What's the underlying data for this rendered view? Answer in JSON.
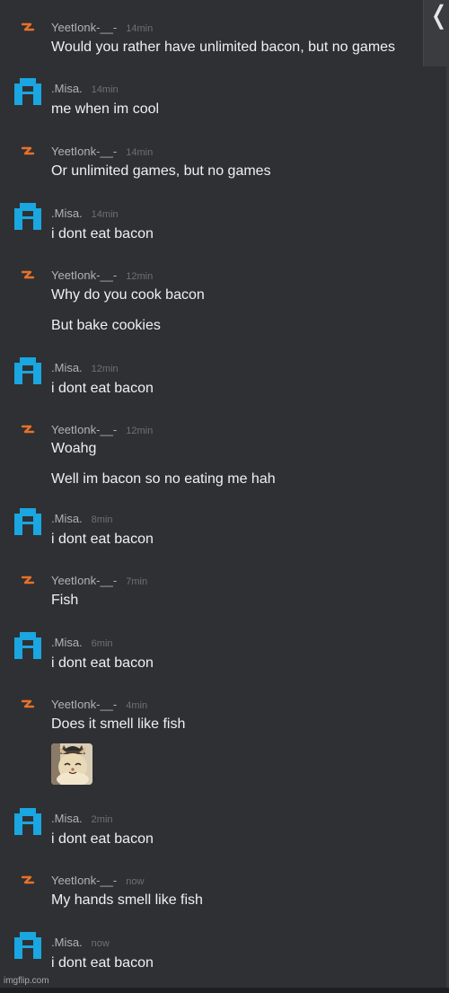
{
  "colors": {
    "background": "#2f3033",
    "author": "#b3b3b7",
    "text": "#f0f0f2",
    "yeet_icon": "#e8702a",
    "misa_icon": "#1aa6e0"
  },
  "handle": {
    "label": "❬"
  },
  "watermark": "imgflip.com",
  "messages": [
    {
      "author": "YeetIonk-__-",
      "time": "14min",
      "icon": "orange-bolt-icon",
      "lines": [
        "Would you rather have unlimited bacon, but no games"
      ]
    },
    {
      "author": ".Misa.",
      "time": "14min",
      "icon": "blue-pixel-avatar-icon",
      "lines": [
        "me when im cool"
      ]
    },
    {
      "author": "YeetIonk-__-",
      "time": "14min",
      "icon": "orange-bolt-icon",
      "lines": [
        "Or unlimited games, but no games"
      ]
    },
    {
      "author": ".Misa.",
      "time": "14min",
      "icon": "blue-pixel-avatar-icon",
      "lines": [
        "i dont eat bacon"
      ]
    },
    {
      "author": "YeetIonk-__-",
      "time": "12min",
      "icon": "orange-bolt-icon",
      "lines": [
        "Why do you cook bacon",
        "But bake cookies"
      ]
    },
    {
      "author": ".Misa.",
      "time": "12min",
      "icon": "blue-pixel-avatar-icon",
      "lines": [
        "i dont eat bacon"
      ]
    },
    {
      "author": "YeetIonk-__-",
      "time": "12min",
      "icon": "orange-bolt-icon",
      "lines": [
        "Woahg",
        "Well im bacon so no eating me hah"
      ]
    },
    {
      "author": ".Misa.",
      "time": "8min",
      "icon": "blue-pixel-avatar-icon",
      "lines": [
        "i dont eat bacon"
      ]
    },
    {
      "author": "YeetIonk-__-",
      "time": "7min",
      "icon": "orange-bolt-icon",
      "lines": [
        "Fish"
      ]
    },
    {
      "author": ".Misa.",
      "time": "6min",
      "icon": "blue-pixel-avatar-icon",
      "lines": [
        "i dont eat bacon"
      ]
    },
    {
      "author": "YeetIonk-__-",
      "time": "4min",
      "icon": "orange-bolt-icon",
      "lines": [
        "Does it smell like fish"
      ],
      "image": "cat-photo"
    },
    {
      "author": ".Misa.",
      "time": "2min",
      "icon": "blue-pixel-avatar-icon",
      "lines": [
        "i dont eat bacon"
      ]
    },
    {
      "author": "YeetIonk-__-",
      "time": "now",
      "icon": "orange-bolt-icon",
      "lines": [
        "My hands smell like fish"
      ]
    },
    {
      "author": ".Misa.",
      "time": "now",
      "icon": "blue-pixel-avatar-icon",
      "lines": [
        "i dont eat bacon"
      ]
    }
  ]
}
